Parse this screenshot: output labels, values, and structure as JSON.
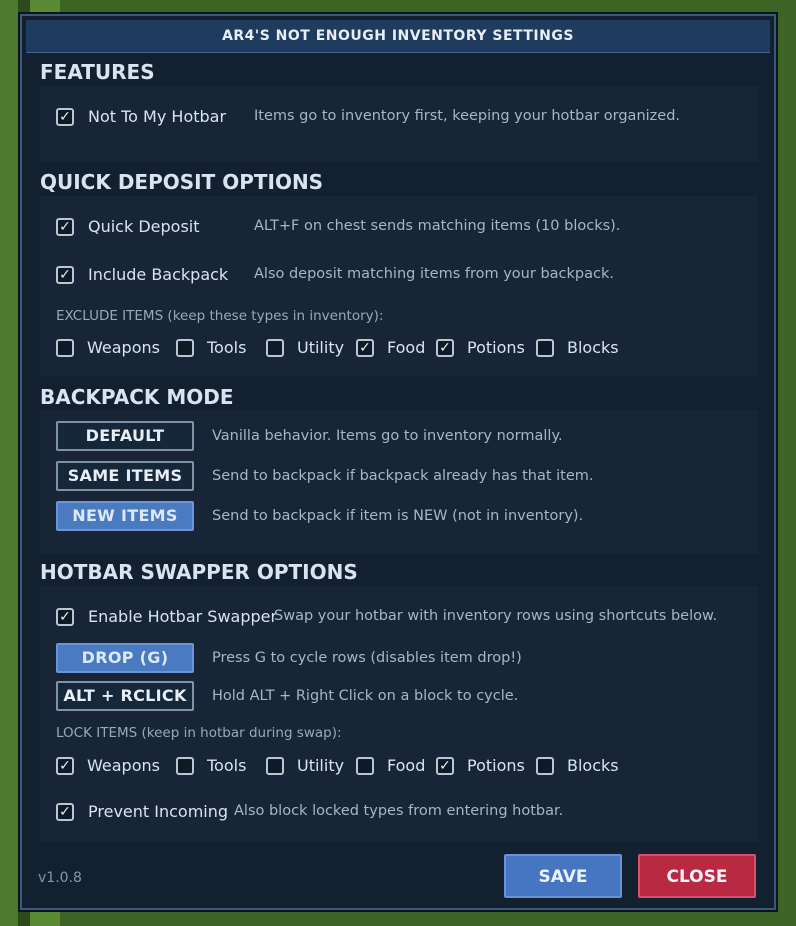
{
  "window": {
    "title": "AR4'S NOT ENOUGH INVENTORY SETTINGS"
  },
  "features": {
    "title": "FEATURES",
    "not_to_hotbar": {
      "label": "Not To My Hotbar",
      "checked": true,
      "desc": "Items go to inventory first, keeping your hotbar organized."
    }
  },
  "quick_deposit": {
    "title": "QUICK DEPOSIT OPTIONS",
    "quick_deposit": {
      "label": "Quick Deposit",
      "checked": true,
      "desc": "ALT+F on chest sends matching items (10 blocks)."
    },
    "include_backpack": {
      "label": "Include Backpack",
      "checked": true,
      "desc": "Also deposit matching items from your backpack."
    },
    "exclude_label": "EXCLUDE ITEMS (keep these types in inventory):",
    "exclude": [
      {
        "label": "Weapons",
        "checked": false
      },
      {
        "label": "Tools",
        "checked": false
      },
      {
        "label": "Utility",
        "checked": false
      },
      {
        "label": "Food",
        "checked": true
      },
      {
        "label": "Potions",
        "checked": true
      },
      {
        "label": "Blocks",
        "checked": false
      }
    ]
  },
  "backpack_mode": {
    "title": "BACKPACK MODE",
    "options": [
      {
        "label": "DEFAULT",
        "desc": "Vanilla behavior. Items go to inventory normally.",
        "active": false
      },
      {
        "label": "SAME ITEMS",
        "desc": "Send to backpack if backpack already has that item.",
        "active": false
      },
      {
        "label": "NEW ITEMS",
        "desc": "Send to backpack if item is NEW (not in inventory).",
        "active": true
      }
    ]
  },
  "hotbar_swapper": {
    "title": "HOTBAR SWAPPER OPTIONS",
    "enable": {
      "label": "Enable Hotbar Swapper",
      "checked": true,
      "desc": "Swap your hotbar with inventory rows using shortcuts below."
    },
    "modes": [
      {
        "label": "DROP (G)",
        "desc": "Press G to cycle rows (disables item drop!)",
        "active": true
      },
      {
        "label": "ALT + RCLICK",
        "desc": "Hold ALT + Right Click on a block to cycle.",
        "active": false
      }
    ],
    "lock_label": "LOCK ITEMS (keep in hotbar during swap):",
    "lock": [
      {
        "label": "Weapons",
        "checked": true
      },
      {
        "label": "Tools",
        "checked": false
      },
      {
        "label": "Utility",
        "checked": false
      },
      {
        "label": "Food",
        "checked": false
      },
      {
        "label": "Potions",
        "checked": true
      },
      {
        "label": "Blocks",
        "checked": false
      }
    ],
    "prevent_incoming": {
      "label": "Prevent Incoming",
      "checked": true,
      "desc": "Also block locked types from entering hotbar."
    }
  },
  "footer": {
    "version": "v1.0.8",
    "save_label": "SAVE",
    "close_label": "CLOSE"
  },
  "colors": {
    "accent": "#4a7ac0",
    "danger": "#b92a42",
    "panel": "#132030",
    "title_bar": "#1f3c5e"
  },
  "icons": {
    "checkbox_checked": "check-icon"
  }
}
